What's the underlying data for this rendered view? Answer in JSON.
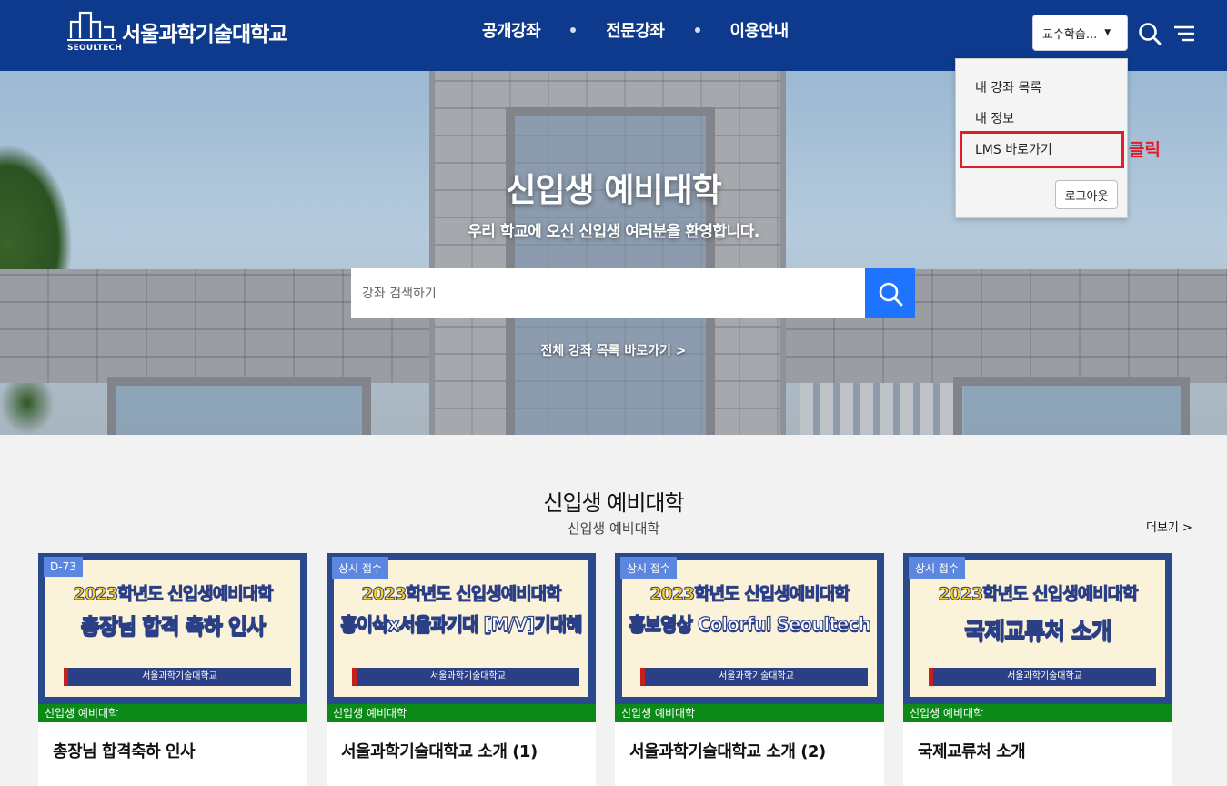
{
  "header": {
    "logo_en": "SEOULTECH",
    "logo_ko": "서울과학기술대학교",
    "nav": [
      "공개강좌",
      "전문강좌",
      "이용안내"
    ],
    "user_select": "교수학습..."
  },
  "dropdown": {
    "items": [
      "내 강좌 목록",
      "내 정보",
      "LMS 바로가기"
    ],
    "logout": "로그아웃",
    "click_note": "클릭"
  },
  "hero": {
    "title": "신입생 예비대학",
    "subtitle": "우리 학교에 오신 신입생 여러분을 환영합니다.",
    "search_placeholder": "강좌 검색하기",
    "all_link": "전체 강좌 목록 바로가기 >"
  },
  "section": {
    "title": "신입생 예비대학",
    "subtitle": "신입생 예비대학",
    "more": "더보기 >"
  },
  "cards": [
    {
      "badge": "D-73",
      "year": "2023학년도 신입생예비대학",
      "main": "총장님 합격 축하 인사",
      "bar": "서울과학기술대학교",
      "category": "신입생 예비대학",
      "title": "총장님 합격축하 인사"
    },
    {
      "badge": "상시 접수",
      "year": "2023학년도 신입생예비대학",
      "main": "홍이삭x서울과기대 [M/V]기대해",
      "bar": "서울과학기술대학교",
      "category": "신입생 예비대학",
      "title": "서울과학기술대학교 소개 (1)"
    },
    {
      "badge": "상시 접수",
      "year": "2023학년도 신입생예비대학",
      "main": "홍보영상 Colorful Seoultech",
      "bar": "서울과학기술대학교",
      "category": "신입생 예비대학",
      "title": "서울과학기술대학교 소개 (2)"
    },
    {
      "badge": "상시 접수",
      "year": "2023학년도 신입생예비대학",
      "main": "국제교류처 소개",
      "bar": "서울과학기술대학교",
      "category": "신입생 예비대학",
      "title": "국제교류처 소개"
    }
  ],
  "colors": {
    "header": "#0d3a8c",
    "accent": "#1e73ff",
    "highlight": "#e21d2b",
    "category": "#0b8a17"
  }
}
